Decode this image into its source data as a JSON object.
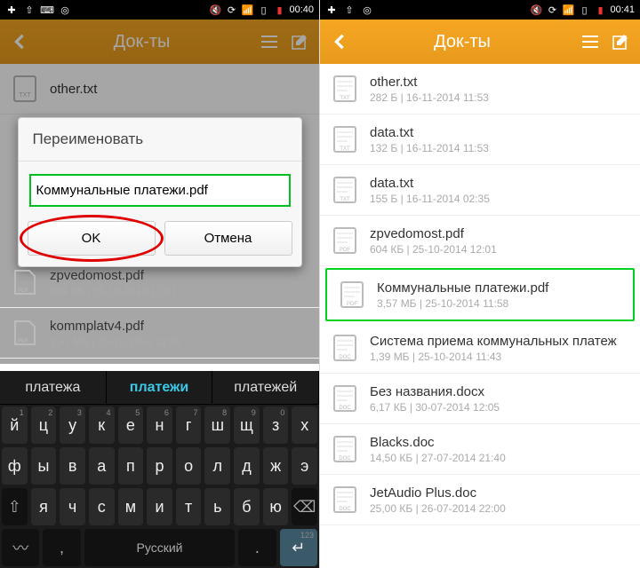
{
  "left": {
    "status_time": "00:40",
    "header": {
      "title": "Док-ты"
    },
    "bg_files": [
      {
        "name": "other.txt",
        "meta": ""
      },
      {
        "name": "kommplatv4.pdf",
        "meta": "3,57 МБ | 25-10-2014 11:58"
      }
    ],
    "bg_pdf_mid": {
      "name": "zpvedomost.pdf",
      "meta": "604 КБ | 25-10-2014 12:01"
    },
    "dialog": {
      "title": "Переименовать",
      "value": "Коммунальные платежи.pdf",
      "ok": "OK",
      "cancel": "Отмена"
    },
    "suggest": [
      "платежа",
      "платежи",
      "платежей"
    ],
    "kbd_rows": {
      "r1": [
        "й",
        "ц",
        "у",
        "к",
        "е",
        "н",
        "г",
        "ш",
        "щ",
        "з",
        "х"
      ],
      "r1h": [
        "1",
        "2",
        "3",
        "4",
        "5",
        "6",
        "7",
        "8",
        "9",
        "0",
        ""
      ],
      "r2": [
        "ф",
        "ы",
        "в",
        "а",
        "п",
        "р",
        "о",
        "л",
        "д",
        "ж",
        "э"
      ],
      "r3": [
        "я",
        "ч",
        "с",
        "м",
        "и",
        "т",
        "ь",
        "б",
        "ю"
      ],
      "space": "Русский",
      "num": "123"
    }
  },
  "right": {
    "status_time": "00:41",
    "header": {
      "title": "Док-ты"
    },
    "files": [
      {
        "name": "other.txt",
        "meta": "282 Б | 16-11-2014 11:53",
        "type": "txt"
      },
      {
        "name": "data.txt",
        "meta": "132 Б | 16-11-2014 11:53",
        "type": "txt"
      },
      {
        "name": "data.txt",
        "meta": "155 Б | 16-11-2014 02:35",
        "type": "txt"
      },
      {
        "name": "zpvedomost.pdf",
        "meta": "604 КБ | 25-10-2014 12:01",
        "type": "pdf"
      },
      {
        "name": "Коммунальные платежи.pdf",
        "meta": "3,57 МБ | 25-10-2014 11:58",
        "type": "pdf",
        "hl": true
      },
      {
        "name": "Система приема коммунальных платеж",
        "meta": "1,39 МБ | 25-10-2014 11:43",
        "type": "doc"
      },
      {
        "name": "Без названия.docx",
        "meta": "6,17 КБ | 30-07-2014 12:05",
        "type": "doc"
      },
      {
        "name": "Blacks.doc",
        "meta": "14,50 КБ | 27-07-2014 21:40",
        "type": "doc"
      },
      {
        "name": "JetAudio Plus.doc",
        "meta": "25,00 КБ | 26-07-2014 22:00",
        "type": "doc"
      }
    ]
  }
}
